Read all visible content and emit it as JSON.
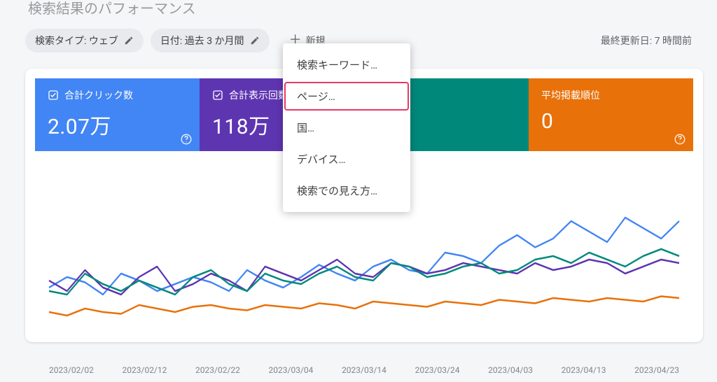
{
  "page_title": "検索結果のパフォーマンス",
  "filters": {
    "search_type": "検索タイプ: ウェブ",
    "date_range": "日付: 過去 3 か月間",
    "add_new": "新規"
  },
  "last_updated": "最終更新日: 7 時間前",
  "metrics": {
    "clicks": {
      "label": "合計クリック数",
      "value": "2.07万"
    },
    "impressions": {
      "label": "合計表示回数",
      "value": "118万"
    },
    "ctr": {
      "label": "",
      "value": ""
    },
    "position": {
      "label": "平均掲載順位",
      "value": "0"
    }
  },
  "menu": {
    "query": "検索キーワード…",
    "page": "ページ…",
    "country": "国…",
    "device": "デバイス…",
    "appearance": "検索での見え方…"
  },
  "chart_data": {
    "type": "line",
    "x_labels": [
      "2023/02/02",
      "2023/02/12",
      "2023/02/22",
      "2023/03/04",
      "2023/03/14",
      "2023/03/24",
      "2023/04/03",
      "2023/04/13",
      "2023/04/23"
    ],
    "ylim": [
      0,
      100
    ],
    "series": [
      {
        "name": "clicks",
        "color": "#4285f4",
        "values": [
          32,
          38,
          35,
          28,
          40,
          36,
          30,
          34,
          38,
          35,
          30,
          42,
          36,
          32,
          38,
          45,
          40,
          36,
          44,
          48,
          42,
          40,
          52,
          50,
          46,
          56,
          62,
          55,
          60,
          70,
          64,
          58,
          72,
          66,
          60,
          70
        ]
      },
      {
        "name": "impressions",
        "color": "#5e35b1",
        "values": [
          36,
          30,
          42,
          32,
          28,
          38,
          44,
          30,
          34,
          40,
          36,
          30,
          44,
          40,
          36,
          42,
          48,
          40,
          38,
          46,
          44,
          40,
          42,
          46,
          44,
          42,
          40,
          46,
          42,
          44,
          48,
          46,
          40,
          44,
          48,
          46
        ]
      },
      {
        "name": "ctr",
        "color": "#00897b",
        "values": [
          30,
          28,
          40,
          34,
          30,
          36,
          32,
          28,
          38,
          42,
          34,
          30,
          40,
          36,
          34,
          40,
          44,
          38,
          36,
          46,
          44,
          38,
          40,
          44,
          46,
          40,
          42,
          48,
          50,
          46,
          52,
          48,
          44,
          50,
          54,
          50
        ]
      },
      {
        "name": "position",
        "color": "#e8710a",
        "values": [
          18,
          16,
          20,
          18,
          17,
          22,
          20,
          18,
          21,
          22,
          20,
          19,
          22,
          21,
          20,
          23,
          22,
          20,
          24,
          23,
          22,
          21,
          24,
          23,
          22,
          25,
          24,
          23,
          26,
          25,
          24,
          26,
          25,
          24,
          27,
          26
        ]
      }
    ]
  }
}
